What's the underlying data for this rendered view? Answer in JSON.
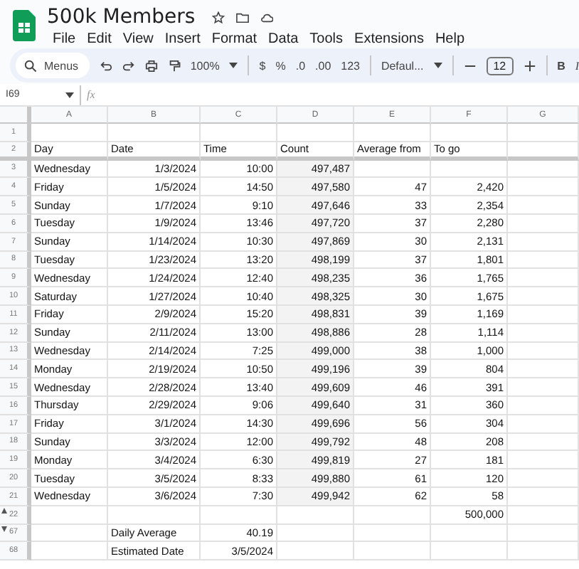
{
  "document": {
    "title": "500k Members"
  },
  "menu": [
    "File",
    "Edit",
    "View",
    "Insert",
    "Format",
    "Data",
    "Tools",
    "Extensions",
    "Help"
  ],
  "toolbar": {
    "search_placeholder": "Menus",
    "zoom": "100%",
    "currency": "$",
    "percent": "%",
    "decrease_decimals": ".0",
    "increase_decimals": ".00",
    "number_format": "123",
    "font": "Defaul...",
    "font_size": "12",
    "bold": "B",
    "italic": "I"
  },
  "formula_bar": {
    "cell_ref": "I69",
    "fx": "fx"
  },
  "columns": [
    {
      "label": "A",
      "shaded": false
    },
    {
      "label": "B",
      "shaded": false
    },
    {
      "label": "C",
      "shaded": false
    },
    {
      "label": "D",
      "shaded": true
    },
    {
      "label": "E",
      "shaded": false
    },
    {
      "label": "F",
      "shaded": false
    },
    {
      "label": "G",
      "shaded": false
    }
  ],
  "rows": [
    {
      "number": "1",
      "kind": "label",
      "cells": []
    },
    {
      "number": "2",
      "kind": "label",
      "cells": [
        "Day",
        "Date",
        "Time",
        "Count",
        "Average from",
        "To go"
      ]
    },
    {
      "number": "3",
      "kind": "data",
      "cells": [
        "Wednesday",
        "1/3/2024",
        "10:00",
        "497,487"
      ]
    },
    {
      "number": "4",
      "kind": "data",
      "cells": [
        "Friday",
        "1/5/2024",
        "14:50",
        "497,580",
        "47",
        "2,420"
      ]
    },
    {
      "number": "5",
      "kind": "data",
      "cells": [
        "Sunday",
        "1/7/2024",
        "9:10",
        "497,646",
        "33",
        "2,354"
      ]
    },
    {
      "number": "6",
      "kind": "data",
      "cells": [
        "Tuesday",
        "1/9/2024",
        "13:46",
        "497,720",
        "37",
        "2,280"
      ]
    },
    {
      "number": "7",
      "kind": "data",
      "cells": [
        "Sunday",
        "1/14/2024",
        "10:30",
        "497,869",
        "30",
        "2,131"
      ]
    },
    {
      "number": "8",
      "kind": "data",
      "cells": [
        "Tuesday",
        "1/23/2024",
        "13:20",
        "498,199",
        "37",
        "1,801"
      ]
    },
    {
      "number": "9",
      "kind": "data",
      "cells": [
        "Wednesday",
        "1/24/2024",
        "12:40",
        "498,235",
        "36",
        "1,765"
      ]
    },
    {
      "number": "10",
      "kind": "data",
      "cells": [
        "Saturday",
        "1/27/2024",
        "10:40",
        "498,325",
        "30",
        "1,675"
      ]
    },
    {
      "number": "11",
      "kind": "data",
      "cells": [
        "Friday",
        "2/9/2024",
        "15:20",
        "498,831",
        "39",
        "1,169"
      ]
    },
    {
      "number": "12",
      "kind": "data",
      "cells": [
        "Sunday",
        "2/11/2024",
        "13:00",
        "498,886",
        "28",
        "1,114"
      ]
    },
    {
      "number": "13",
      "kind": "data",
      "cells": [
        "Wednesday",
        "2/14/2024",
        "7:25",
        "499,000",
        "38",
        "1,000"
      ]
    },
    {
      "number": "14",
      "kind": "data",
      "cells": [
        "Monday",
        "2/19/2024",
        "10:50",
        "499,196",
        "39",
        "804"
      ]
    },
    {
      "number": "15",
      "kind": "data",
      "cells": [
        "Wednesday",
        "2/28/2024",
        "13:40",
        "499,609",
        "46",
        "391"
      ]
    },
    {
      "number": "16",
      "kind": "data",
      "cells": [
        "Thursday",
        "2/29/2024",
        "9:06",
        "499,640",
        "31",
        "360"
      ]
    },
    {
      "number": "17",
      "kind": "data",
      "cells": [
        "Friday",
        "3/1/2024",
        "14:30",
        "499,696",
        "56",
        "304"
      ]
    },
    {
      "number": "18",
      "kind": "data",
      "cells": [
        "Sunday",
        "3/3/2024",
        "12:00",
        "499,792",
        "48",
        "208"
      ]
    },
    {
      "number": "19",
      "kind": "data",
      "cells": [
        "Monday",
        "3/4/2024",
        "6:30",
        "499,819",
        "27",
        "181"
      ]
    },
    {
      "number": "20",
      "kind": "data",
      "cells": [
        "Tuesday",
        "3/5/2024",
        "8:33",
        "499,880",
        "61",
        "120"
      ]
    },
    {
      "number": "21",
      "kind": "data",
      "cells": [
        "Wednesday",
        "3/6/2024",
        "7:30",
        "499,942",
        "62",
        "58"
      ]
    },
    {
      "number": "22",
      "kind": "total",
      "hidden_rows_after": true,
      "cells": [
        "",
        "",
        "",
        "",
        "",
        "500,000"
      ]
    },
    {
      "number": "67",
      "kind": "summary",
      "hidden_rows_before": true,
      "cells": [
        "",
        "Daily Average",
        "40.19"
      ]
    },
    {
      "number": "68",
      "kind": "summary",
      "cells": [
        "",
        "Estimated Date",
        "3/5/2024"
      ]
    }
  ]
}
